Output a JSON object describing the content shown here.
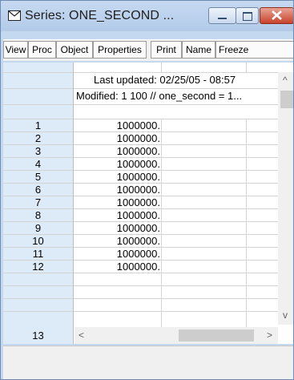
{
  "window": {
    "title": "Series: ONE_SECOND ...",
    "minimize_icon": "minimize-icon",
    "maximize_icon": "maximize-icon",
    "close_icon": "close-icon"
  },
  "toolbar": {
    "buttons": [
      "View",
      "Proc",
      "Object",
      "Properties",
      "Print",
      "Name",
      "Freeze"
    ]
  },
  "sheet": {
    "last_updated": "Last updated: 02/25/05 - 08:57",
    "modified": "Modified: 1 100 // one_second = 1...",
    "rows": [
      {
        "n": "1",
        "v": "1000000."
      },
      {
        "n": "2",
        "v": "1000000."
      },
      {
        "n": "3",
        "v": "1000000."
      },
      {
        "n": "4",
        "v": "1000000."
      },
      {
        "n": "5",
        "v": "1000000."
      },
      {
        "n": "6",
        "v": "1000000."
      },
      {
        "n": "7",
        "v": "1000000."
      },
      {
        "n": "8",
        "v": "1000000."
      },
      {
        "n": "9",
        "v": "1000000."
      },
      {
        "n": "10",
        "v": "1000000."
      },
      {
        "n": "11",
        "v": "1000000."
      },
      {
        "n": "12",
        "v": "1000000."
      },
      {
        "n": "13",
        "v": ""
      }
    ]
  },
  "scrollbars": {
    "up": "^",
    "down": "v",
    "left": "<",
    "right": ">"
  }
}
